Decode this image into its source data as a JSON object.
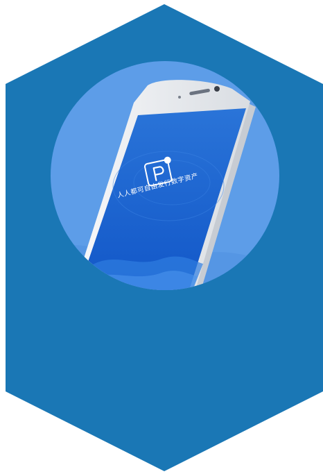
{
  "app": {
    "tagline": "人人都可自由发行数字资产"
  },
  "colors": {
    "hexagon": "#1a77b5",
    "circle_bg": "#5d9de8",
    "screen_top": "#2a74d8",
    "screen_bottom": "#1257c8",
    "phone_frame": "#f2f4f7",
    "phone_edge": "#c7ccd3"
  },
  "icons": {
    "app_logo": "p-logo-icon"
  }
}
